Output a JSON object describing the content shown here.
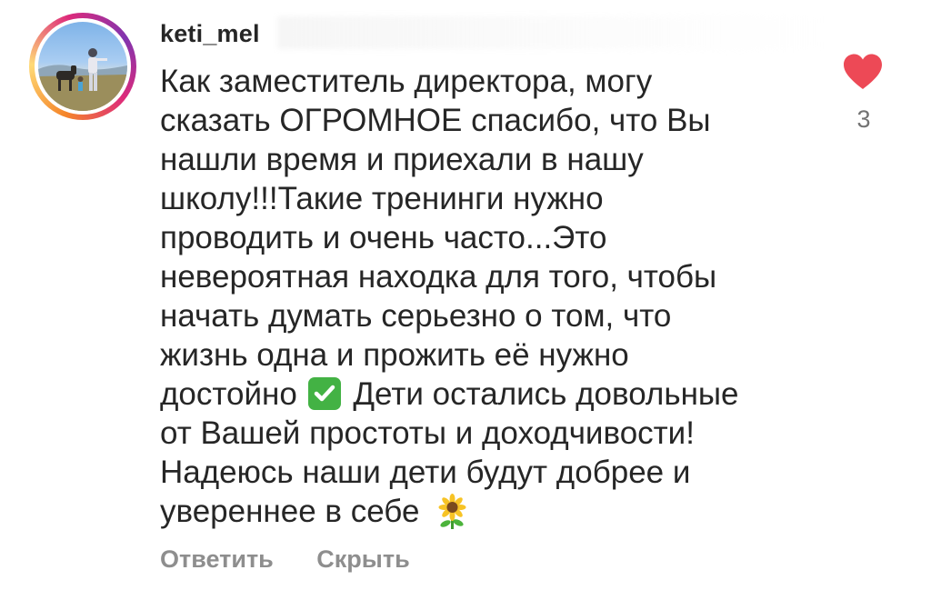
{
  "comment": {
    "username": "keti_mel",
    "lines": [
      "Как заместитель директора, могу",
      "сказать ОГРОМНОЕ спасибо, что Вы",
      "нашли время и приехали в нашу",
      "школу!!!Такие тренинги нужно",
      "проводить и очень часто...Это",
      "невероятная находка для того, чтобы",
      "начать думать серьезно о том, что",
      "жизнь одна и прожить её нужно",
      "достойно",
      "Дети остались довольные",
      "от Вашей простоты и  доходчивости!",
      "Надеюсь наши дети будут добрее и",
      "увереннее в себе"
    ],
    "like_count": "3",
    "reply_label": "Ответить",
    "hide_label": "Скрыть",
    "icons": {
      "avatar": "avatar",
      "like": "heart-icon",
      "check_emoji": "check-mark-button-emoji",
      "sunflower_emoji": "sunflower-emoji"
    },
    "colors": {
      "heart": "#ed4956",
      "check": "#43b244",
      "secondary_text": "#8e8e8e"
    }
  }
}
